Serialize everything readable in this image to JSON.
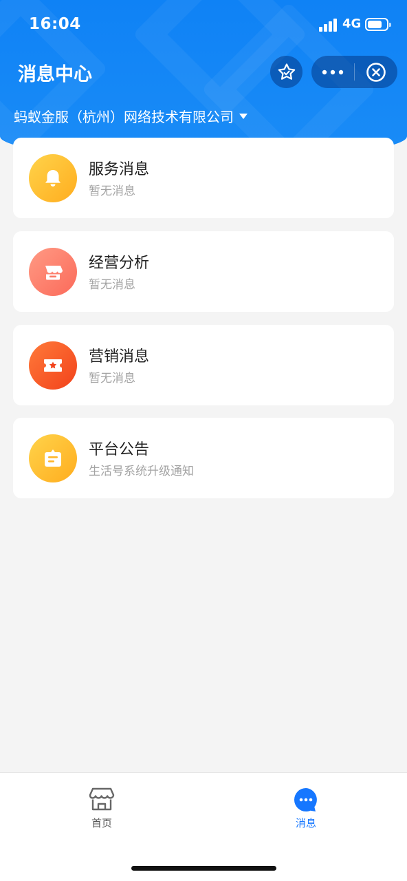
{
  "status_bar": {
    "time": "16:04",
    "network": "4G",
    "battery_level": 0.8
  },
  "header": {
    "title": "消息中心",
    "organization": "蚂蚁金服（杭州）网络技术有限公司",
    "bg_color": "#0f82f5"
  },
  "messages": [
    {
      "icon": "bell-icon",
      "title": "服务消息",
      "subtitle": "暂无消息",
      "color_from": "#ffd34a",
      "color_to": "#ffad1f"
    },
    {
      "icon": "store-icon",
      "title": "经营分析",
      "subtitle": "暂无消息",
      "color_from": "#ff9a84",
      "color_to": "#fb6a5a"
    },
    {
      "icon": "ticket-star-icon",
      "title": "营销消息",
      "subtitle": "暂无消息",
      "color_from": "#ff7a3a",
      "color_to": "#f2421b"
    },
    {
      "icon": "notice-board-icon",
      "title": "平台公告",
      "subtitle": "生活号系统升级通知",
      "color_from": "#ffd34a",
      "color_to": "#ffad1f"
    }
  ],
  "tabbar": {
    "items": [
      {
        "label": "首页",
        "icon": "store-icon",
        "active": false,
        "color": "#555555"
      },
      {
        "label": "消息",
        "icon": "chat-bubble-icon",
        "active": true,
        "color": "#1677ff"
      }
    ]
  }
}
